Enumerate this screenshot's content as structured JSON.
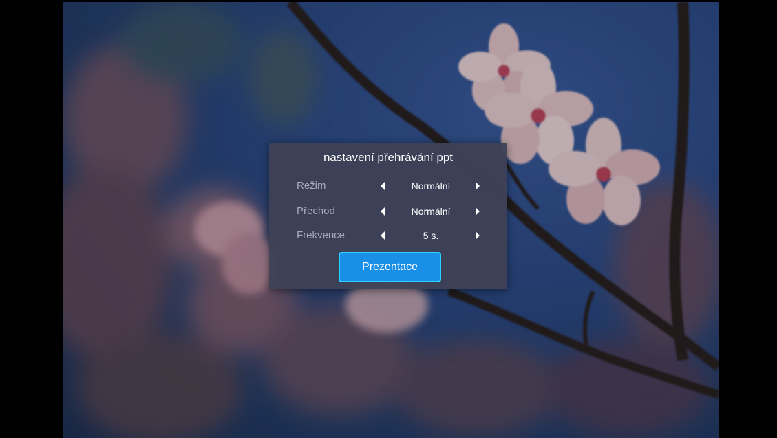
{
  "dialog": {
    "title": "nastavení přehrávání ppt",
    "rows": [
      {
        "label": "Režim",
        "value": "Normální"
      },
      {
        "label": "Přechod",
        "value": "Normální"
      },
      {
        "label": "Frekvence",
        "value": "5 s."
      }
    ],
    "button_label": "Prezentace"
  },
  "colors": {
    "dialog_bg": "#3e4256",
    "label": "#a8abbb",
    "button_bg": "#1a8fe8",
    "button_border": "#2fd0ff",
    "sky": "#2f4f8f"
  },
  "icons": [
    "arrow-left-icon",
    "arrow-right-icon"
  ]
}
